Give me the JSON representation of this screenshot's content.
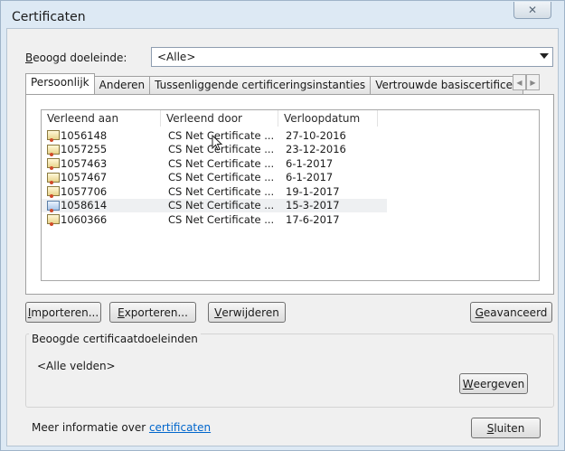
{
  "window": {
    "title": "Certificaten"
  },
  "purpose": {
    "label_accel": "B",
    "label_rest": "eoogd doeleinde:",
    "selected": "<Alle>"
  },
  "tabs": [
    {
      "label": "Persoonlijk"
    },
    {
      "label": "Anderen"
    },
    {
      "label": "Tussenliggende certificeringsinstanties"
    },
    {
      "label": "Vertrouwde basiscertificeringsinstanties"
    }
  ],
  "list": {
    "columns": [
      "Verleend aan",
      "Verleend door",
      "Verloopdatum"
    ],
    "rows": [
      {
        "issued_to": "1056148",
        "issued_by": "CS Net Certificate ...",
        "expires": "27-10-2016"
      },
      {
        "issued_to": "1057255",
        "issued_by": "CS Net Certificate ...",
        "expires": "23-12-2016"
      },
      {
        "issued_to": "1057463",
        "issued_by": "CS Net Certificate ...",
        "expires": "6-1-2017"
      },
      {
        "issued_to": "1057467",
        "issued_by": "CS Net Certificate ...",
        "expires": "6-1-2017"
      },
      {
        "issued_to": "1057706",
        "issued_by": "CS Net Certificate ...",
        "expires": "19-1-2017"
      },
      {
        "issued_to": "1058614",
        "issued_by": "CS Net Certificate ...",
        "expires": "15-3-2017"
      },
      {
        "issued_to": "1060366",
        "issued_by": "CS Net Certificate ...",
        "expires": "17-6-2017"
      }
    ]
  },
  "buttons": {
    "import_accel": "I",
    "import_rest": "mporteren...",
    "export_accel": "E",
    "export_rest": "xporteren...",
    "remove_accel": "V",
    "remove_rest": "erwijderen",
    "advanced_accel": "G",
    "advanced_rest": "eavanceerd",
    "view_accel": "W",
    "view_rest": "eergeven",
    "close_accel": "S",
    "close_rest": "luiten"
  },
  "purposes_group": {
    "legend": "Beoogde certificaatdoeleinden",
    "value": "<Alle velden>"
  },
  "more_info": {
    "text": "Meer informatie over ",
    "link": "certificaten"
  },
  "colors": {
    "link": "#0066cc",
    "window_frame": "#dde9f4"
  }
}
